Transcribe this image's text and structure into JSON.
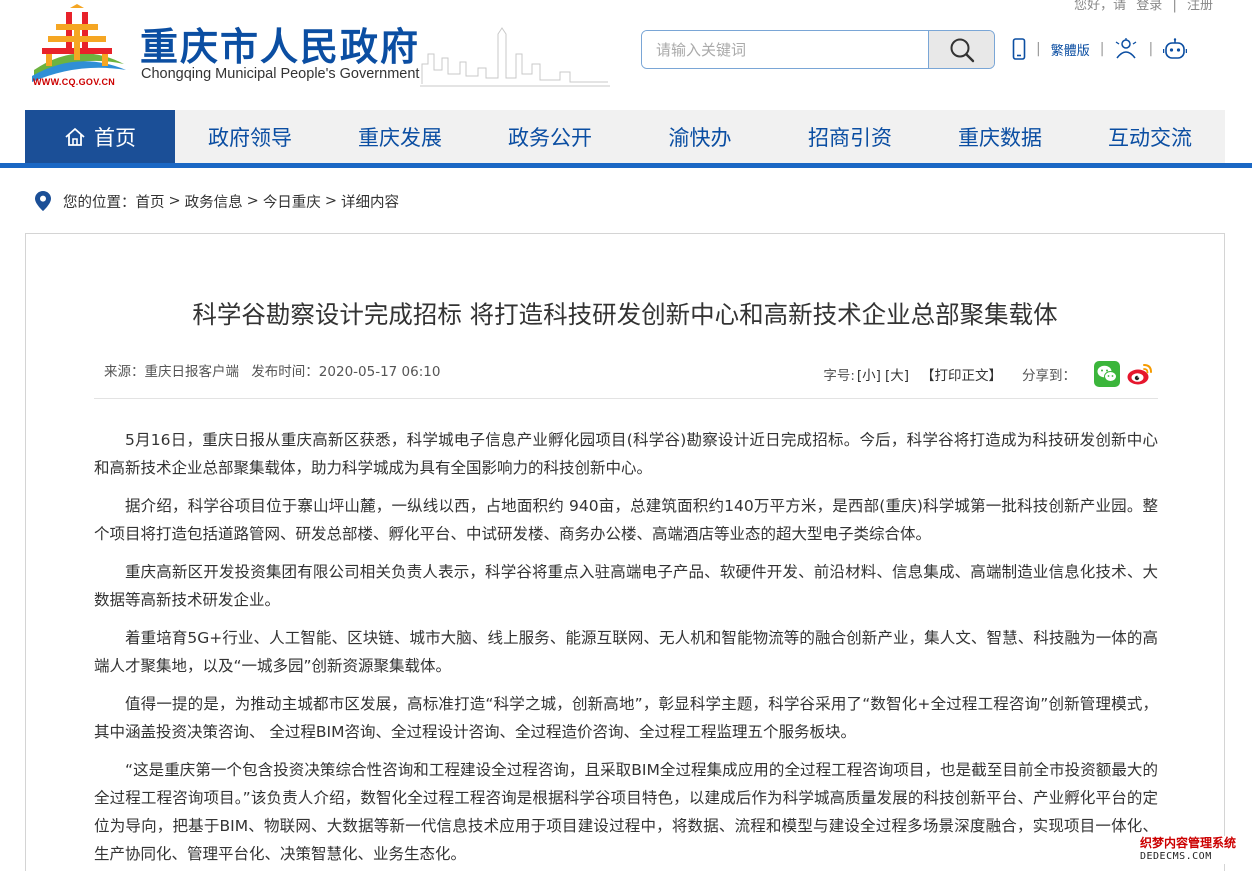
{
  "header": {
    "login": {
      "greeting": "您好，请",
      "login_label": "登录",
      "separator": "|",
      "register_label": "注册"
    },
    "logo_cn": "重庆市人民政府",
    "logo_en": "Chongqing Municipal People's Government",
    "logo_url": "WWW.CQ.GOV.CN",
    "search_placeholder": "请输入关键词",
    "traditional_label": "繁體版",
    "separator": "|"
  },
  "nav": {
    "items": [
      {
        "label": "首页"
      },
      {
        "label": "政府领导"
      },
      {
        "label": "重庆发展"
      },
      {
        "label": "政务公开"
      },
      {
        "label": "渝快办"
      },
      {
        "label": "招商引资"
      },
      {
        "label": "重庆数据"
      },
      {
        "label": "互动交流"
      }
    ]
  },
  "breadcrumb": {
    "prefix": "您的位置：",
    "items": [
      "首页",
      "政务信息",
      "今日重庆",
      "详细内容"
    ],
    "arrow": ">"
  },
  "article": {
    "title": "科学谷勘察设计完成招标 将打造科技研发创新中心和高新技术企业总部聚集载体",
    "source": "来源：重庆日报客户端",
    "time": "发布时间：2020-05-17 06:10",
    "font_size_label": "字号:",
    "font_small": "[小]",
    "font_large": "[大]",
    "print_label": "【打印正文】",
    "share_label": "分享到：",
    "paragraphs": [
      "5月16日，重庆日报从重庆高新区获悉，科学城电子信息产业孵化园项目(科学谷)勘察设计近日完成招标。今后，科学谷将打造成为科技研发创新中心和高新技术企业总部聚集载体，助力科学城成为具有全国影响力的科技创新中心。",
      "据介绍，科学谷项目位于寨山坪山麓，一纵线以西，占地面积约 940亩，总建筑面积约140万平方米，是西部(重庆)科学城第一批科技创新产业园。整个项目将打造包括道路管网、研发总部楼、孵化平台、中试研发楼、商务办公楼、高端酒店等业态的超大型电子类综合体。",
      "重庆高新区开发投资集团有限公司相关负责人表示，科学谷将重点入驻高端电子产品、软硬件开发、前沿材料、信息集成、高端制造业信息化技术、大数据等高新技术研发企业。",
      "着重培育5G+行业、人工智能、区块链、城市大脑、线上服务、能源互联网、无人机和智能物流等的融合创新产业，集人文、智慧、科技融为一体的高端人才聚集地，以及“一城多园”创新资源聚集载体。",
      "值得一提的是，为推动主城都市区发展，高标准打造“科学之城，创新高地”，彰显科学主题，科学谷采用了“数智化+全过程工程咨询”创新管理模式，其中涵盖投资决策咨询、 全过程BIM咨询、全过程设计咨询、全过程造价咨询、全过程工程监理五个服务板块。",
      "“这是重庆第一个包含投资决策综合性咨询和工程建设全过程咨询，且采取BIM全过程集成应用的全过程工程咨询项目，也是截至目前全市投资额最大的全过程工程咨询项目。”该负责人介绍，数智化全过程工程咨询是根据科学谷项目特色，以建成后作为科学城高质量发展的科技创新平台、产业孵化平台的定位为导向，把基于BIM、物联网、大数据等新一代信息技术应用于项目建设过程中，将数据、流程和模型与建设全过程多场景深度融合，实现项目一体化、生产协同化、管理平台化、决策智慧化、业务生态化。"
    ]
  },
  "watermark": {
    "line1": "织梦内容管理系统",
    "line2": "DEDECMS.COM"
  },
  "colors": {
    "brand_blue": "#0b4ea2",
    "nav_active": "#1b4f97",
    "nav_line": "#1a67c4",
    "wechat": "#3bb53b",
    "weibo": "#e6162d"
  }
}
